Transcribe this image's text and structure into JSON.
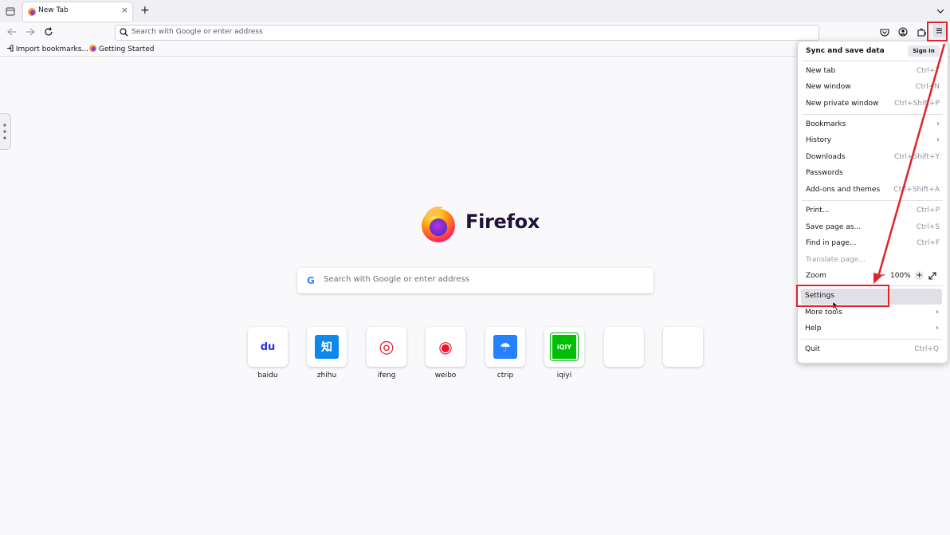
{
  "tab": {
    "title": "New Tab",
    "close": "×",
    "new": "+"
  },
  "navbar": {
    "url_placeholder": "Search with Google or enter address"
  },
  "bookmarks": [
    {
      "label": "Import bookmarks..."
    },
    {
      "label": "Getting Started"
    }
  ],
  "newtab": {
    "brand": "Firefox",
    "search_placeholder": "Search with Google or enter address",
    "search_engine_glyph": "G",
    "sites": [
      {
        "label": "baidu",
        "icon": "baidu-icon",
        "color": "#2932e1",
        "glyph": "du"
      },
      {
        "label": "zhihu",
        "icon": "zhihu-icon",
        "color": "#0f88eb",
        "glyph": "知"
      },
      {
        "label": "ifeng",
        "icon": "ifeng-icon",
        "color": "#e0242d",
        "glyph": "◎"
      },
      {
        "label": "weibo",
        "icon": "weibo-icon",
        "color": "#e6162d",
        "glyph": "◉"
      },
      {
        "label": "ctrip",
        "icon": "ctrip-icon",
        "color": "#2681ff",
        "glyph": "☂"
      },
      {
        "label": "iqiyi",
        "icon": "iqiyi-icon",
        "color": "#00be06",
        "glyph": "iQIY"
      }
    ]
  },
  "menu": {
    "sync_title": "Sync and save data",
    "sign_in": "Sign In",
    "items": {
      "new_tab": {
        "label": "New tab",
        "shortcut": "Ctrl+T"
      },
      "new_window": {
        "label": "New window",
        "shortcut": "Ctrl+N"
      },
      "new_private_window": {
        "label": "New private window",
        "shortcut": "Ctrl+Shift+P"
      },
      "bookmarks": {
        "label": "Bookmarks"
      },
      "history": {
        "label": "History"
      },
      "downloads": {
        "label": "Downloads",
        "shortcut": "Ctrl+Shift+Y"
      },
      "passwords": {
        "label": "Passwords"
      },
      "addons": {
        "label": "Add-ons and themes",
        "shortcut": "Ctrl+Shift+A"
      },
      "print": {
        "label": "Print...",
        "shortcut": "Ctrl+P"
      },
      "save_page": {
        "label": "Save page as...",
        "shortcut": "Ctrl+S"
      },
      "find": {
        "label": "Find in page...",
        "shortcut": "Ctrl+F"
      },
      "translate": {
        "label": "Translate page..."
      },
      "zoom": {
        "label": "Zoom",
        "value": "100%",
        "plus": "+",
        "minus": "−"
      },
      "settings": {
        "label": "Settings"
      },
      "more_tools": {
        "label": "More tools"
      },
      "help": {
        "label": "Help"
      },
      "quit": {
        "label": "Quit",
        "shortcut": "Ctrl+Q"
      }
    }
  },
  "colors": {
    "annotation": "#e0242d",
    "accent": "#7542e5"
  }
}
